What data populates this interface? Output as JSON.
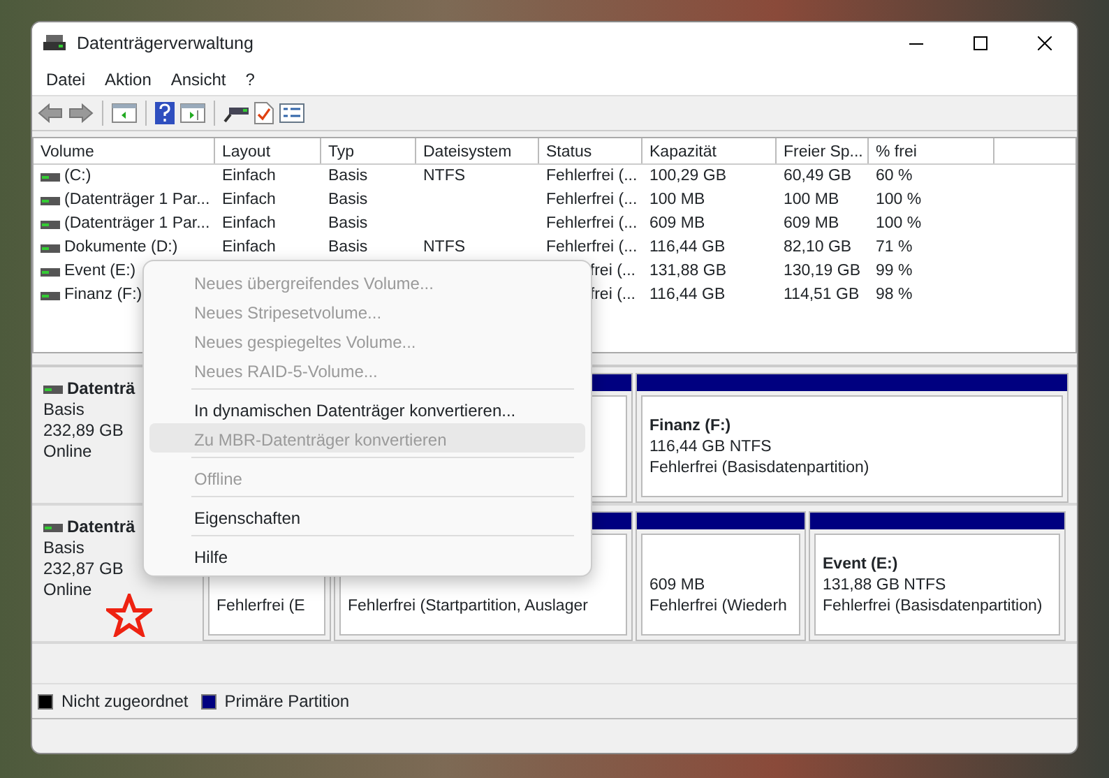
{
  "window": {
    "title": "Datenträgerverwaltung"
  },
  "menu_bar": [
    "Datei",
    "Aktion",
    "Ansicht",
    "?"
  ],
  "volume_table": {
    "columns": [
      "Volume",
      "Layout",
      "Typ",
      "Dateisystem",
      "Status",
      "Kapazität",
      "Freier Sp...",
      "% frei"
    ],
    "rows": [
      [
        "(C:)",
        "Einfach",
        "Basis",
        "NTFS",
        "Fehlerfrei (...",
        "100,29 GB",
        "60,49 GB",
        "60 %"
      ],
      [
        "(Datenträger 1 Par...",
        "Einfach",
        "Basis",
        "",
        "Fehlerfrei (...",
        "100 MB",
        "100 MB",
        "100 %"
      ],
      [
        "(Datenträger 1 Par...",
        "Einfach",
        "Basis",
        "",
        "Fehlerfrei (...",
        "609 MB",
        "609 MB",
        "100 %"
      ],
      [
        "Dokumente (D:)",
        "Einfach",
        "Basis",
        "NTFS",
        "Fehlerfrei (...",
        "116,44 GB",
        "82,10 GB",
        "71 %"
      ],
      [
        "Event (E:)",
        "",
        "",
        "",
        "frei (...",
        "131,88 GB",
        "130,19 GB",
        "99 %"
      ],
      [
        "Finanz (F:)",
        "",
        "",
        "",
        "frei (...",
        "116,44 GB",
        "114,51 GB",
        "98 %"
      ]
    ]
  },
  "disk_map": {
    "disks": [
      {
        "name": "Datenträ",
        "type": "Basis",
        "size": "232,89 GB",
        "status": "Online",
        "partitions": [
          {
            "kind": "hidden"
          },
          {
            "kind": "volume",
            "name": "Finanz  (F:)",
            "size": "116,44 GB NTFS",
            "status": "Fehlerfrei (Basisdatenpartition)"
          }
        ]
      },
      {
        "name": "Datenträ",
        "type": "Basis",
        "size": "232,87 GB",
        "status": "Online",
        "partitions": [
          {
            "kind": "volume",
            "status": "Fehlerfrei (E"
          },
          {
            "kind": "volume",
            "status": "Fehlerfrei (Startpartition, Auslager"
          },
          {
            "kind": "volume",
            "size": "609 MB",
            "status": "Fehlerfrei (Wiederh"
          },
          {
            "kind": "volume",
            "name": "Event  (E:)",
            "size": "131,88 GB NTFS",
            "status": "Fehlerfrei (Basisdatenpartition)"
          }
        ]
      }
    ]
  },
  "legend": [
    {
      "label": "Nicht zugeordnet",
      "color": "#000000"
    },
    {
      "label": "Primäre Partition",
      "color": "#000080"
    }
  ],
  "context_menu": [
    {
      "kind": "item",
      "label": "Neues übergreifendes Volume...",
      "disabled": true,
      "highlighted": false
    },
    {
      "kind": "item",
      "label": "Neues Stripesetvolume...",
      "disabled": true,
      "highlighted": false
    },
    {
      "kind": "item",
      "label": "Neues gespiegeltes Volume...",
      "disabled": true,
      "highlighted": false
    },
    {
      "kind": "item",
      "label": "Neues RAID-5-Volume...",
      "disabled": true,
      "highlighted": false
    },
    {
      "kind": "separator"
    },
    {
      "kind": "item",
      "label": "In dynamischen Datenträger konvertieren...",
      "disabled": false,
      "highlighted": false
    },
    {
      "kind": "item",
      "label": "Zu MBR-Datenträger konvertieren",
      "disabled": true,
      "highlighted": true
    },
    {
      "kind": "separator"
    },
    {
      "kind": "item",
      "label": "Offline",
      "disabled": true,
      "highlighted": false
    },
    {
      "kind": "separator"
    },
    {
      "kind": "item",
      "label": "Eigenschaften",
      "disabled": false,
      "highlighted": false
    },
    {
      "kind": "separator"
    },
    {
      "kind": "item",
      "label": "Hilfe",
      "disabled": false,
      "highlighted": false
    }
  ]
}
